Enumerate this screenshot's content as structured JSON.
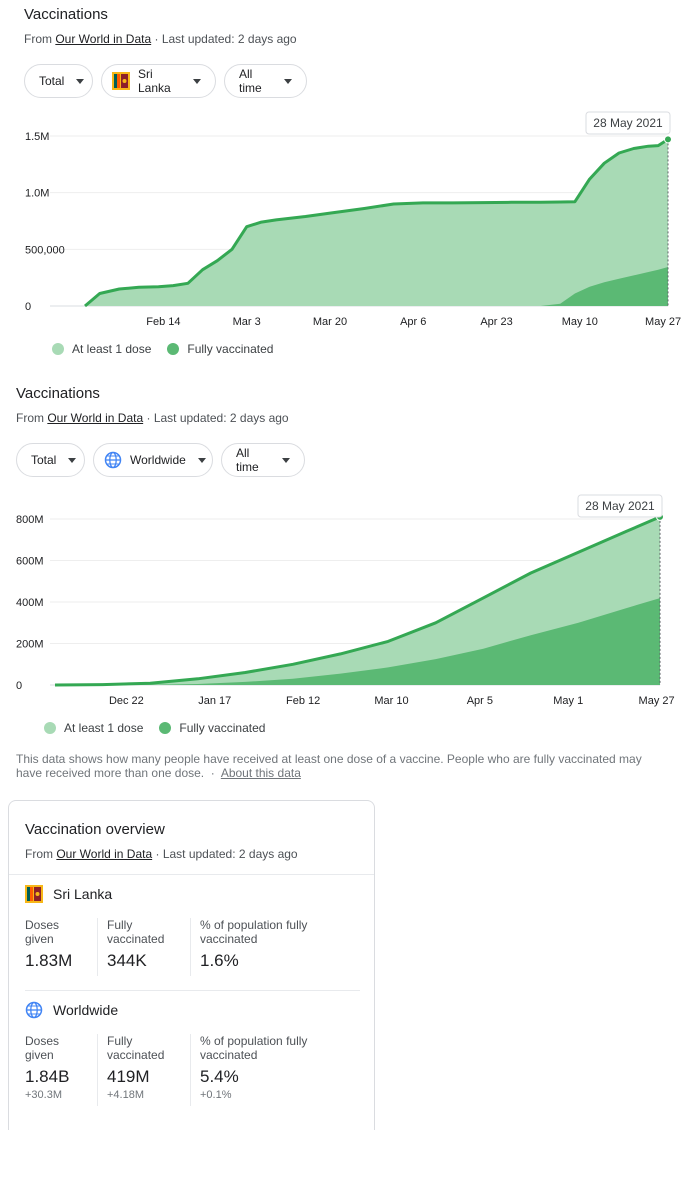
{
  "chart1": {
    "title": "Vaccinations",
    "source_prefix": "From ",
    "source_link": "Our World in Data",
    "updated": " · Last updated: 2 days ago",
    "filters": {
      "metric": "Total",
      "region": "Sri Lanka",
      "range": "All time"
    },
    "tooltip": "28 May 2021",
    "legend": [
      "At least 1 dose",
      "Fully vaccinated"
    ],
    "colors": {
      "at_least_one_fill": "#a8dab5",
      "line": "#34a853",
      "fully_fill": "#5bb974",
      "dot1": "#a8dab5",
      "dot2": "#5bb974"
    }
  },
  "chart2": {
    "title": "Vaccinations",
    "source_prefix": "From ",
    "source_link": "Our World in Data",
    "updated": " · Last updated: 2 days ago",
    "filters": {
      "metric": "Total",
      "region": "Worldwide",
      "range": "All time"
    },
    "tooltip": "28 May 2021",
    "legend": [
      "At least 1 dose",
      "Fully vaccinated"
    ]
  },
  "chart_data": [
    {
      "type": "area",
      "title": "",
      "xlabel": "",
      "ylabel": "",
      "x_ticks": [
        "Feb 14",
        "Mar 3",
        "Mar 20",
        "Apr 6",
        "Apr 23",
        "May 10",
        "May 27"
      ],
      "y_ticks": [
        "0",
        "500,000",
        "1.0M",
        "1.5M"
      ],
      "ylim": [
        0,
        1500000
      ],
      "x": [
        "2021-01-29",
        "2021-02-01",
        "2021-02-05",
        "2021-02-09",
        "2021-02-13",
        "2021-02-16",
        "2021-02-19",
        "2021-02-22",
        "2021-02-25",
        "2021-02-28",
        "2021-03-03",
        "2021-03-06",
        "2021-03-09",
        "2021-03-15",
        "2021-03-20",
        "2021-03-27",
        "2021-04-02",
        "2021-04-08",
        "2021-04-14",
        "2021-04-20",
        "2021-04-26",
        "2021-05-02",
        "2021-05-06",
        "2021-05-09",
        "2021-05-12",
        "2021-05-15",
        "2021-05-18",
        "2021-05-21",
        "2021-05-24",
        "2021-05-26",
        "2021-05-28"
      ],
      "series": [
        {
          "name": "At least 1 dose",
          "values": [
            0,
            110000,
            150000,
            165000,
            170000,
            180000,
            200000,
            320000,
            400000,
            500000,
            700000,
            740000,
            760000,
            790000,
            820000,
            860000,
            900000,
            910000,
            910000,
            912000,
            915000,
            915000,
            918000,
            920000,
            1120000,
            1260000,
            1350000,
            1390000,
            1410000,
            1415000,
            1470000
          ]
        },
        {
          "name": "Fully vaccinated",
          "values": [
            0,
            0,
            0,
            0,
            0,
            0,
            0,
            0,
            0,
            0,
            0,
            0,
            0,
            0,
            0,
            0,
            0,
            0,
            0,
            0,
            0,
            0,
            20000,
            110000,
            170000,
            210000,
            240000,
            270000,
            300000,
            320000,
            344000
          ]
        }
      ]
    },
    {
      "type": "area",
      "title": "",
      "xlabel": "",
      "ylabel": "",
      "x_ticks": [
        "Dec 22",
        "Jan 17",
        "Feb 12",
        "Mar 10",
        "Apr 5",
        "May 1",
        "May 27"
      ],
      "y_ticks": [
        "0",
        "200M",
        "400M",
        "600M",
        "800M"
      ],
      "ylim": [
        0,
        800000000
      ],
      "x": [
        "2020-12-01",
        "2020-12-15",
        "2020-12-29",
        "2021-01-12",
        "2021-01-26",
        "2021-02-09",
        "2021-02-23",
        "2021-03-09",
        "2021-03-23",
        "2021-04-06",
        "2021-04-20",
        "2021-05-04",
        "2021-05-18",
        "2021-05-28"
      ],
      "series": [
        {
          "name": "At least 1 dose",
          "values": [
            0,
            2000000,
            8000000,
            30000000,
            60000000,
            100000000,
            150000000,
            210000000,
            300000000,
            420000000,
            540000000,
            640000000,
            740000000,
            810000000
          ]
        },
        {
          "name": "Fully vaccinated",
          "values": [
            0,
            0,
            1000000,
            5000000,
            15000000,
            30000000,
            55000000,
            85000000,
            125000000,
            175000000,
            240000000,
            300000000,
            370000000,
            419000000
          ]
        }
      ]
    }
  ],
  "note": {
    "text": "This data shows how many people have received at least one dose of a vaccine. People who are fully vaccinated may have received more than one dose.",
    "sep": "·",
    "link": "About this data"
  },
  "overview": {
    "title": "Vaccination overview",
    "source_prefix": "From ",
    "source_link": "Our World in Data",
    "updated": " · Last updated: 2 days ago",
    "headers": {
      "doses_l1": "Doses",
      "doses_l2": "given",
      "fully_l1": "Fully",
      "fully_l2": "vaccinated",
      "pct_l1": "% of population fully",
      "pct_l2": "vaccinated"
    },
    "sri_lanka": {
      "name": "Sri Lanka",
      "doses": "1.83M",
      "fully": "344K",
      "pct": "1.6%"
    },
    "worldwide": {
      "name": "Worldwide",
      "doses": "1.84B",
      "doses_delta": "+30.3M",
      "fully": "419M",
      "fully_delta": "+4.18M",
      "pct": "5.4%",
      "pct_delta": "+0.1%"
    }
  }
}
